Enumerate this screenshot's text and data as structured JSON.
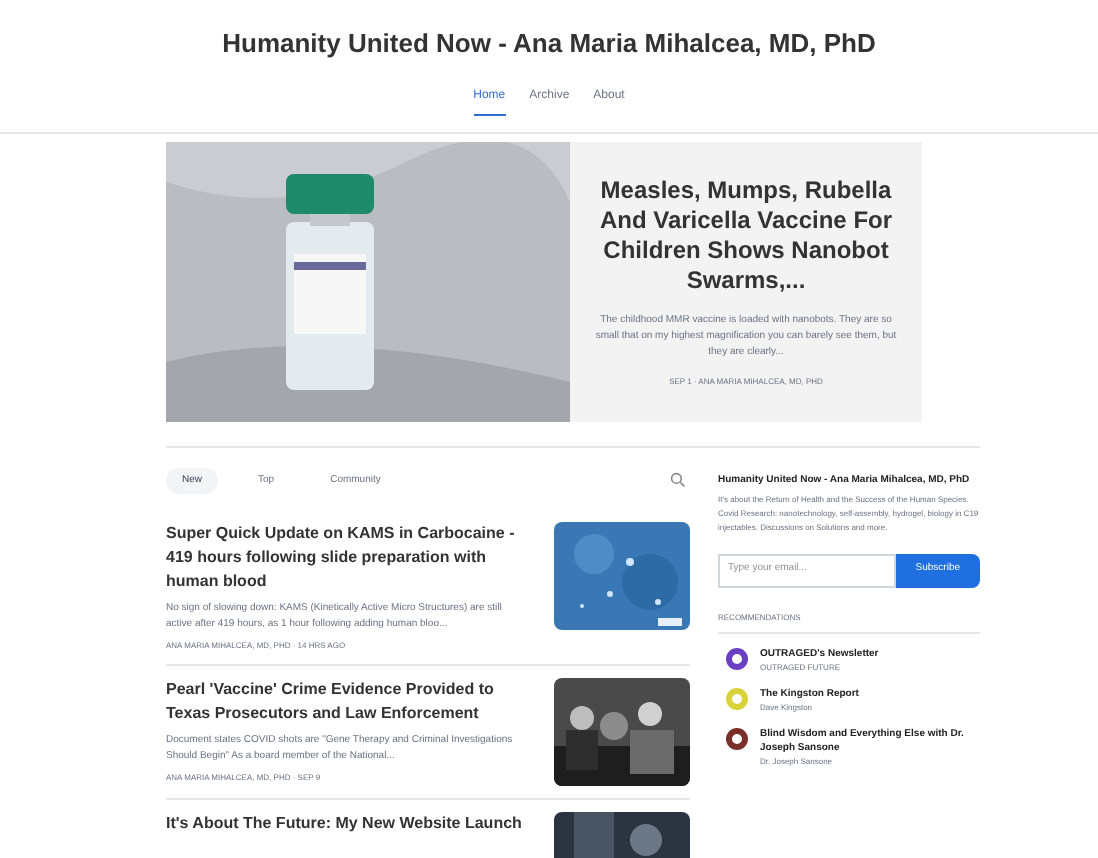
{
  "header": {
    "title": "Humanity United Now - Ana Maria Mihalcea, MD, PhD"
  },
  "nav": [
    {
      "label": "Home",
      "selected": true
    },
    {
      "label": "Archive",
      "selected": false
    },
    {
      "label": "About",
      "selected": false
    }
  ],
  "hero": {
    "title": "Measles, Mumps, Rubella And Varicella Vaccine For Children Shows Nanobot Swarms,...",
    "excerpt": "The childhood MMR vaccine is loaded with nanobots. They are so small that on my highest magnification you can barely see them, but they are clearly...",
    "byline": "SEP 1 · ANA MARIA MIHALCEA, MD, PHD"
  },
  "feed_tabs": [
    {
      "label": "New",
      "selected": true
    },
    {
      "label": "Top",
      "selected": false
    },
    {
      "label": "Community",
      "selected": false
    }
  ],
  "posts": [
    {
      "title": "Super Quick Update on KAMS in Carbocaine - 419 hours following slide preparation with human blood",
      "excerpt": "No sign of slowing down: KAMS (Kinetically Active Micro Structures) are still active after 419 hours, as 1 hour following adding human bloo...",
      "meta": "ANA MARIA MIHALCEA, MD, PHD · 14 HRS AGO"
    },
    {
      "title": "Pearl 'Vaccine' Crime Evidence Provided to Texas Prosecutors and Law Enforcement",
      "excerpt": "Document states COVID shots are \"Gene Therapy and Criminal Investigations Should Begin\" As a board member of the National...",
      "meta": "ANA MARIA MIHALCEA, MD, PHD · SEP 9"
    },
    {
      "title": "It's About The Future: My New Website Launch"
    }
  ],
  "sidebar": {
    "title": "Humanity United Now - Ana Maria Mihalcea, MD, PhD",
    "description": "It's about the Return of Health and the Success of the Human Species. Covid Research: nanotechnology, self-assembly, hydrogel, biology in C19 injectables. Discussions on Solutions and more.",
    "email_placeholder": "Type your email...",
    "subscribe": "Subscribe",
    "recommendations_heading": "RECOMMENDATIONS",
    "recommendations": [
      {
        "name": "OUTRAGED's Newsletter",
        "author": "OUTRAGED FUTURE",
        "color": "#6b3fc4"
      },
      {
        "name": "The Kingston Report",
        "author": "Dave Kingston",
        "color": "#d9d23a"
      },
      {
        "name": "Blind Wisdom and Everything Else with Dr. Joseph Sansone",
        "author": "Dr. Joseph Sansone",
        "color": "#7a2f2a"
      }
    ]
  }
}
